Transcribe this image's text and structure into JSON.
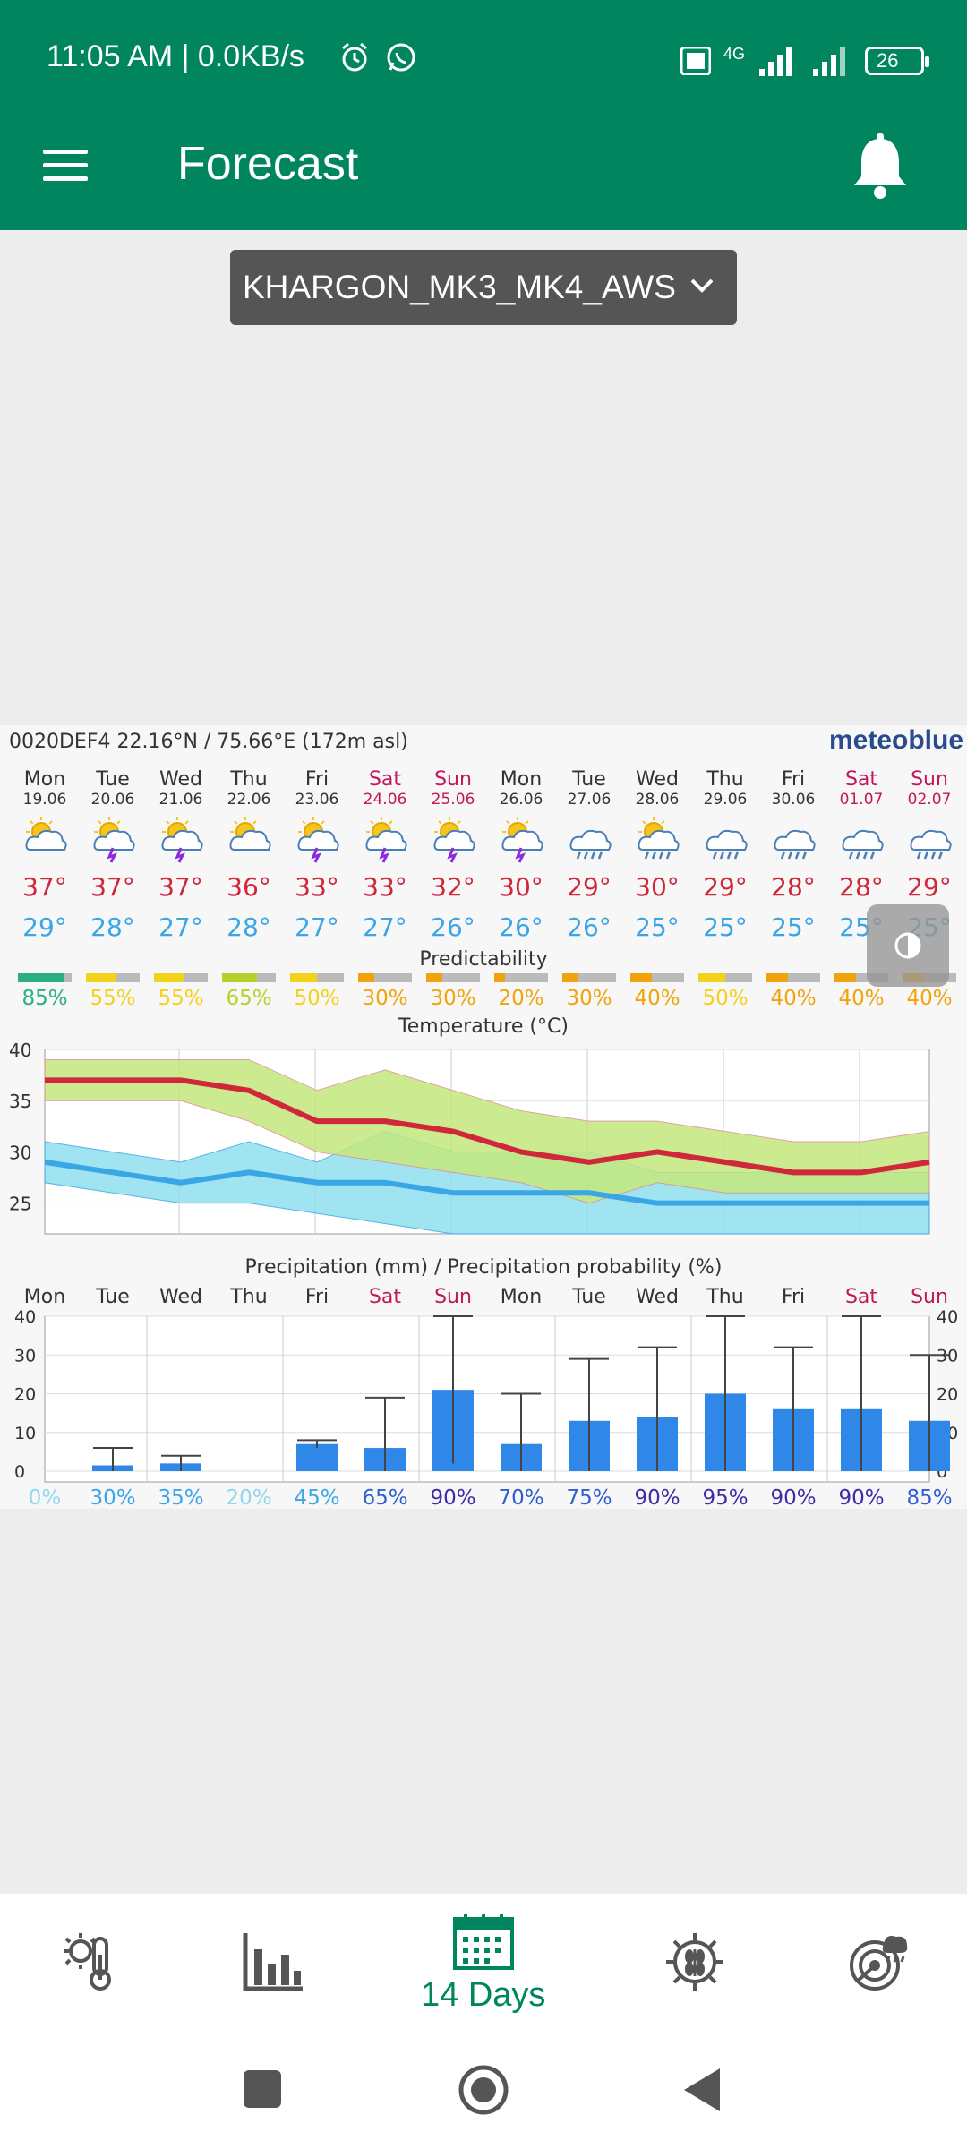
{
  "status": {
    "left": "11:05 AM | 0.0KB/s",
    "battery": "26",
    "network": "4G"
  },
  "app": {
    "title": "Forecast"
  },
  "station": {
    "name": "KHARGON_MK3_MK4_AWS"
  },
  "meteogram": {
    "header": "0020DEF4  22.16°N / 75.66°E (172m asl)",
    "brand": "meteoblue",
    "days": [
      {
        "day": "Mon",
        "date": "19.06",
        "weekend": false,
        "icon": "sun-cloud-icon",
        "tmax": "37°",
        "tmin": "29°",
        "pred": "85%",
        "pred_color": "#2ab07f"
      },
      {
        "day": "Tue",
        "date": "20.06",
        "weekend": false,
        "icon": "thunderstorm-sun-icon",
        "tmax": "37°",
        "tmin": "28°",
        "pred": "55%",
        "pred_color": "#f2d21b"
      },
      {
        "day": "Wed",
        "date": "21.06",
        "weekend": false,
        "icon": "thunderstorm-sun-icon",
        "tmax": "37°",
        "tmin": "27°",
        "pred": "55%",
        "pred_color": "#f2d21b"
      },
      {
        "day": "Thu",
        "date": "22.06",
        "weekend": false,
        "icon": "sun-cloud-icon",
        "tmax": "36°",
        "tmin": "28°",
        "pred": "65%",
        "pred_color": "#b6d12b"
      },
      {
        "day": "Fri",
        "date": "23.06",
        "weekend": false,
        "icon": "thunderstorm-sun-icon",
        "tmax": "33°",
        "tmin": "27°",
        "pred": "50%",
        "pred_color": "#f2d21b"
      },
      {
        "day": "Sat",
        "date": "24.06",
        "weekend": true,
        "icon": "thunderstorm-sun-icon",
        "tmax": "33°",
        "tmin": "27°",
        "pred": "30%",
        "pred_color": "#f0a30a"
      },
      {
        "day": "Sun",
        "date": "25.06",
        "weekend": true,
        "icon": "thunderstorm-sun-icon",
        "tmax": "32°",
        "tmin": "26°",
        "pred": "30%",
        "pred_color": "#f0a30a"
      },
      {
        "day": "Mon",
        "date": "26.06",
        "weekend": false,
        "icon": "thunderstorm-sun-icon",
        "tmax": "30°",
        "tmin": "26°",
        "pred": "20%",
        "pred_color": "#f0a30a"
      },
      {
        "day": "Tue",
        "date": "27.06",
        "weekend": false,
        "icon": "rain-cloud-icon",
        "tmax": "29°",
        "tmin": "26°",
        "pred": "30%",
        "pred_color": "#f0a30a"
      },
      {
        "day": "Wed",
        "date": "28.06",
        "weekend": false,
        "icon": "rain-sun-icon",
        "tmax": "30°",
        "tmin": "25°",
        "pred": "40%",
        "pred_color": "#f0a30a"
      },
      {
        "day": "Thu",
        "date": "29.06",
        "weekend": false,
        "icon": "rain-cloud-icon",
        "tmax": "29°",
        "tmin": "25°",
        "pred": "50%",
        "pred_color": "#f2d21b"
      },
      {
        "day": "Fri",
        "date": "30.06",
        "weekend": false,
        "icon": "rain-cloud-icon",
        "tmax": "28°",
        "tmin": "25°",
        "pred": "40%",
        "pred_color": "#f0a30a"
      },
      {
        "day": "Sat",
        "date": "01.07",
        "weekend": true,
        "icon": "rain-cloud-icon",
        "tmax": "28°",
        "tmin": "25°",
        "pred": "40%",
        "pred_color": "#f0a30a"
      },
      {
        "day": "Sun",
        "date": "02.07",
        "weekend": true,
        "icon": "rain-cloud-icon",
        "tmax": "29°",
        "tmin": "25°",
        "pred": "40%",
        "pred_color": "#f0a30a"
      }
    ],
    "predictability_label": "Predictability",
    "temp_title": "Temperature (°C)",
    "precip_title": "Precipitation (mm) / Precipitation probability (%)",
    "precip_days": [
      "Mon",
      "Tue",
      "Wed",
      "Thu",
      "Fri",
      "Sat",
      "Sun",
      "Mon",
      "Tue",
      "Wed",
      "Thu",
      "Fri",
      "Sat",
      "Sun"
    ],
    "precip_prob": [
      "0%",
      "30%",
      "35%",
      "20%",
      "45%",
      "65%",
      "90%",
      "70%",
      "75%",
      "90%",
      "95%",
      "90%",
      "90%",
      "85%"
    ]
  },
  "chart_data": [
    {
      "type": "line",
      "title": "Temperature (°C)",
      "categories": [
        "19.06",
        "20.06",
        "21.06",
        "22.06",
        "23.06",
        "24.06",
        "25.06",
        "26.06",
        "27.06",
        "28.06",
        "29.06",
        "30.06",
        "01.07",
        "02.07"
      ],
      "ylim": [
        22,
        40
      ],
      "yticks": [
        25,
        30,
        35,
        40
      ],
      "series": [
        {
          "name": "max",
          "values": [
            37,
            37,
            37,
            36,
            33,
            33,
            32,
            30,
            29,
            30,
            29,
            28,
            28,
            29
          ],
          "color": "#d0273a"
        },
        {
          "name": "min",
          "values": [
            29,
            28,
            27,
            28,
            27,
            27,
            26,
            26,
            26,
            25,
            25,
            25,
            25,
            25
          ],
          "color": "#3aa6e6"
        }
      ],
      "max_band_upper": [
        39,
        39,
        39,
        39,
        36,
        38,
        36,
        34,
        33,
        33,
        32,
        31,
        31,
        32
      ],
      "max_band_lower": [
        35,
        35,
        35,
        33,
        30,
        29,
        28,
        27,
        25,
        27,
        26,
        26,
        26,
        26
      ],
      "min_band_upper": [
        31,
        30,
        29,
        31,
        29,
        32,
        30,
        30,
        30,
        28,
        28,
        28,
        28,
        28
      ],
      "min_band_lower": [
        27,
        26,
        25,
        25,
        24,
        23,
        22,
        22,
        22,
        22,
        22,
        22,
        22,
        22
      ]
    },
    {
      "type": "bar",
      "title": "Precipitation (mm) / Precipitation probability (%)",
      "categories": [
        "Mon",
        "Tue",
        "Wed",
        "Thu",
        "Fri",
        "Sat",
        "Sun",
        "Mon",
        "Tue",
        "Wed",
        "Thu",
        "Fri",
        "Sat",
        "Sun"
      ],
      "ylim": [
        0,
        40
      ],
      "yticks": [
        0,
        10,
        20,
        30,
        40
      ],
      "values": [
        0,
        1.5,
        2,
        0,
        7,
        6,
        21,
        7,
        13,
        14,
        20,
        16,
        16,
        13
      ],
      "ranges": [
        [
          0,
          0
        ],
        [
          0,
          6
        ],
        [
          0,
          4
        ],
        [
          0,
          0
        ],
        [
          6,
          8
        ],
        [
          0,
          19
        ],
        [
          2,
          40
        ],
        [
          0,
          20
        ],
        [
          0,
          29
        ],
        [
          0,
          32
        ],
        [
          0,
          40
        ],
        [
          0,
          32
        ],
        [
          0,
          40
        ],
        [
          0,
          30
        ]
      ],
      "probability": [
        "0%",
        "30%",
        "35%",
        "20%",
        "45%",
        "65%",
        "90%",
        "70%",
        "75%",
        "90%",
        "95%",
        "90%",
        "90%",
        "85%"
      ]
    }
  ],
  "bottom_nav": {
    "items": [
      {
        "name": "weather-icon"
      },
      {
        "name": "chart-icon"
      },
      {
        "name": "calendar-icon",
        "label": "14 Days",
        "active": true
      },
      {
        "name": "crop-icon"
      },
      {
        "name": "radar-icon"
      }
    ]
  }
}
